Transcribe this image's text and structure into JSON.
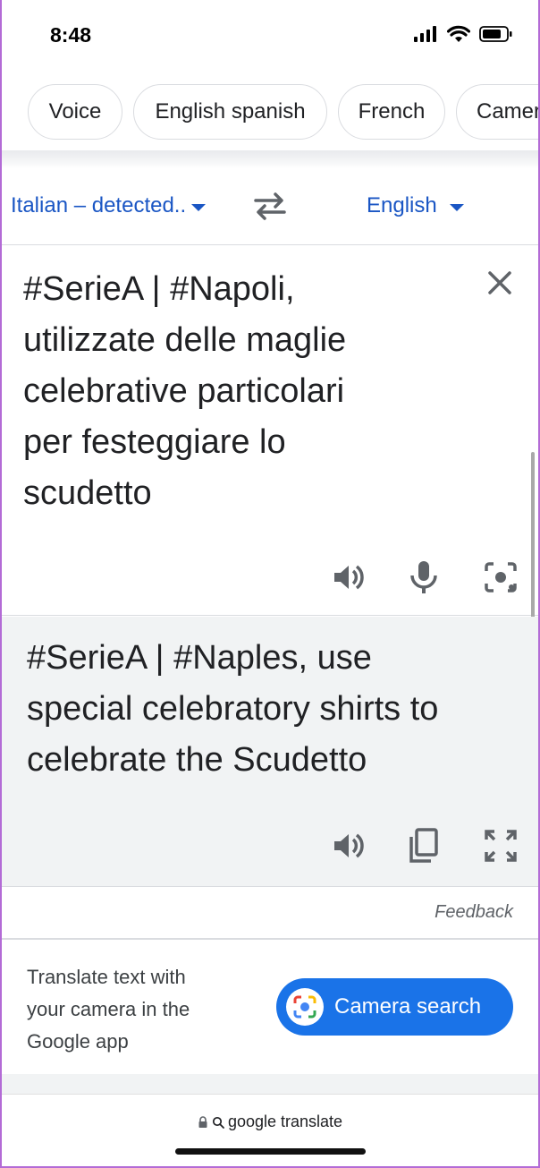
{
  "status_bar": {
    "time": "8:48"
  },
  "chips": [
    "Voice",
    "English spanish",
    "French",
    "Camera"
  ],
  "lang_bar": {
    "source": "Italian – detected..",
    "target": "English"
  },
  "source": {
    "lines": [
      "#SerieA | #Napoli,",
      "utilizzate delle maglie",
      "celebrative particolari",
      "per festeggiare lo",
      "scudetto"
    ]
  },
  "result": {
    "lines": [
      "#SerieA | #Naples, use",
      "special celebratory shirts to",
      "celebrate the Scudetto"
    ]
  },
  "feedback": "Feedback",
  "promo": {
    "lines": [
      "Translate text with",
      "your camera in the",
      "Google app"
    ],
    "button": "Camera search"
  },
  "address_bar": {
    "text": "google translate"
  },
  "colors": {
    "accent": "#1a73e8",
    "link": "#1a56c4",
    "result_bg": "#f1f3f4"
  },
  "icons": [
    "lock-icon",
    "search-icon",
    "swap-icon",
    "close-icon",
    "speaker-icon",
    "mic-icon",
    "camera-icon",
    "copy-icon",
    "fullscreen-icon"
  ]
}
